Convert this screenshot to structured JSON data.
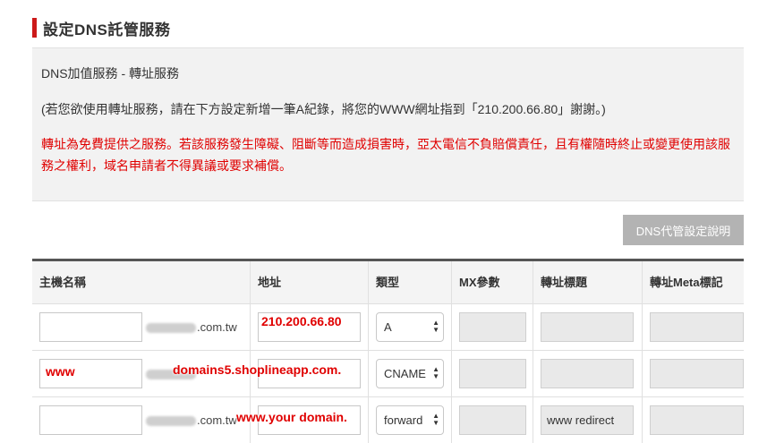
{
  "section": {
    "title": "設定DNS託管服務"
  },
  "info": {
    "line1": "DNS加值服務 - 轉址服務",
    "line2": "(若您欲使用轉址服務，請在下方設定新增一筆A紀錄，將您的WWW網址指到「210.200.66.80」謝謝。)",
    "warning": "轉址為免費提供之服務。若該服務發生障礙、阻斷等而造成損害時，亞太電信不負賠償責任，且有權隨時終止或變更使用該服務之權利，域名申請者不得異議或要求補償。"
  },
  "help_button": {
    "label": "DNS代管設定說明"
  },
  "table": {
    "headers": [
      "主機名稱",
      "地址",
      "類型",
      "MX參數",
      "轉址標題",
      "轉址Meta標記"
    ],
    "rows": [
      {
        "host": "",
        "suffix": ".com.tw",
        "address": "",
        "type": "A",
        "mx": "",
        "redirect_title": "",
        "meta": ""
      },
      {
        "host": "",
        "suffix": "",
        "address": "",
        "type": "CNAME",
        "mx": "",
        "redirect_title": "",
        "meta": ""
      },
      {
        "host": "",
        "suffix": ".com.tw",
        "address": "",
        "type": "forward",
        "mx": "",
        "redirect_title": "www redirect",
        "meta": ""
      }
    ]
  },
  "annotations": {
    "ip": "210.200.66.80",
    "www": "www",
    "cname_target": "domains5.shoplineapp.com.",
    "your_domain": "www.your domain."
  },
  "colors": {
    "accent_red": "#e00000",
    "title_bar": "#cc1a1a",
    "button_gray": "#b3b3b3"
  }
}
